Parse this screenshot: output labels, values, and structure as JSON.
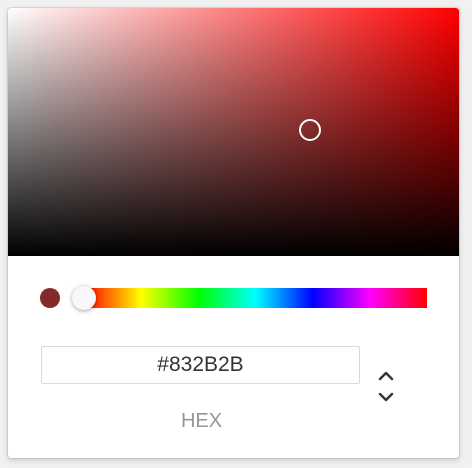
{
  "color": {
    "hex": "#832B2B",
    "format_label": "HEX",
    "hue_color": "#ff0000"
  },
  "state": {
    "hue_degrees": 0,
    "saturation": 0.67,
    "value": 0.51
  },
  "icons": {
    "toggle": "chevron-up-down-icon"
  }
}
